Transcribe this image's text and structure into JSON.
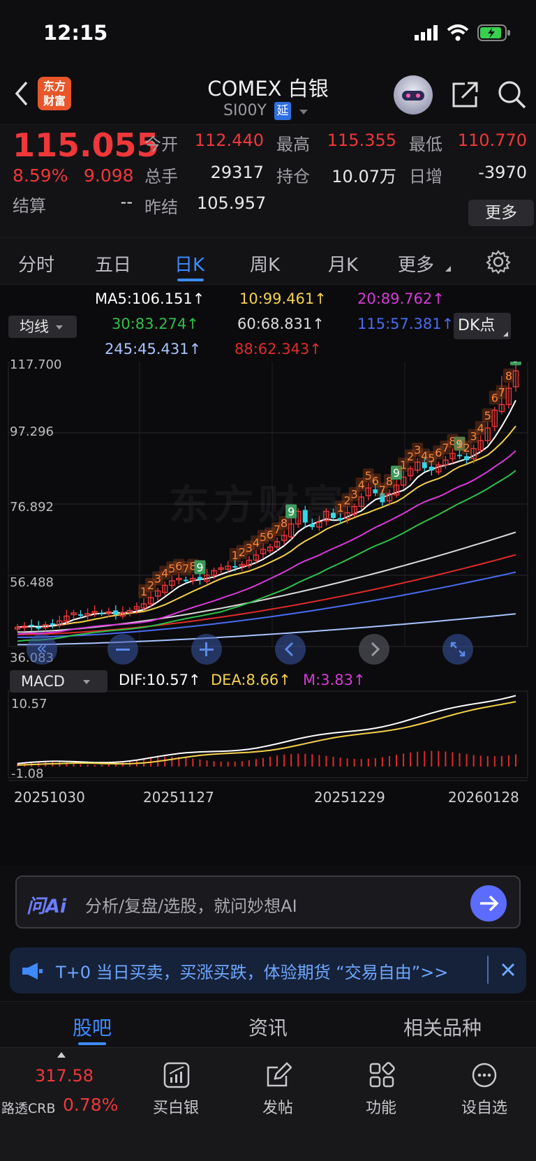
{
  "status": {
    "time": "12:15"
  },
  "header": {
    "title": "COMEX 白银",
    "code": "SI00Y",
    "delay_badge": "延",
    "logo_line1": "东方",
    "logo_line2": "财富"
  },
  "quote": {
    "price": "115.055",
    "change_pct": "8.59%",
    "change": "9.098",
    "settle_label": "结算",
    "settle_value": "--",
    "fields": [
      {
        "label": "今开",
        "value": "112.440",
        "color": "#f0373a"
      },
      {
        "label": "最高",
        "value": "115.355",
        "color": "#f0373a"
      },
      {
        "label": "最低",
        "value": "110.770",
        "color": "#f0373a"
      },
      {
        "label": "总手",
        "value": "29317",
        "color": "#e8e8e8"
      },
      {
        "label": "持仓",
        "value": "10.07万",
        "color": "#e8e8e8"
      },
      {
        "label": "日增",
        "value": "-3970",
        "color": "#e8e8e8"
      },
      {
        "label": "昨结",
        "value": "105.957",
        "color": "#e8e8e8"
      }
    ],
    "more_label": "更多"
  },
  "period_tabs": [
    {
      "label": "分时",
      "active": false
    },
    {
      "label": "五日",
      "active": false
    },
    {
      "label": "日K",
      "active": true
    },
    {
      "label": "周K",
      "active": false
    },
    {
      "label": "月K",
      "active": false
    },
    {
      "label": "更多",
      "active": false
    }
  ],
  "ma": {
    "selector": "均线",
    "dk_label": "DK点",
    "items": [
      {
        "text": "MA5:106.151↑",
        "color": "#ffffff"
      },
      {
        "text": "10:99.461↑",
        "color": "#f5d14a"
      },
      {
        "text": "20:89.762↑",
        "color": "#d83ad8"
      },
      {
        "text": "30:83.274↑",
        "color": "#2fbf4a"
      },
      {
        "text": "60:68.831↑",
        "color": "#dcdcdc"
      },
      {
        "text": "115:57.381↑",
        "color": "#4a6cf0"
      },
      {
        "text": "245:45.431↑",
        "color": "#a9c4ff"
      },
      {
        "text": "88:62.343↑",
        "color": "#e02a2a"
      }
    ]
  },
  "chart_data": [
    {
      "type": "candlestick",
      "y_ticks": [
        "117.700",
        "97.296",
        "76.892",
        "56.488",
        "36.083"
      ],
      "ylim": [
        36.083,
        117.7
      ],
      "watermark": "东方财富",
      "close": [
        41.6,
        41.9,
        42.0,
        41.5,
        42.3,
        42.6,
        43.4,
        44.8,
        45.7,
        44.9,
        45.5,
        46.1,
        45.6,
        46.0,
        45.2,
        45.8,
        46.4,
        47.5,
        48.3,
        50.1,
        52.0,
        53.6,
        54.9,
        55.6,
        54.9,
        55.6,
        55.2,
        56.5,
        57.8,
        58.6,
        59.1,
        58.7,
        59.6,
        60.8,
        62.3,
        63.9,
        64.6,
        66.1,
        67.9,
        71.2,
        74.8,
        71.6,
        70.3,
        71.7,
        74.8,
        72.9,
        72.3,
        74.4,
        76.2,
        78.9,
        81.5,
        80.0,
        77.4,
        79.9,
        82.3,
        84.6,
        87.0,
        88.9,
        87.2,
        86.5,
        88.1,
        89.5,
        91.4,
        90.6,
        89.5,
        92.8,
        95.1,
        98.7,
        103.8,
        105.4,
        110.1,
        115.055
      ],
      "up_seq": [
        "1",
        "2",
        "3",
        "4",
        "5",
        "6",
        "7",
        "8",
        "9"
      ]
    },
    {
      "type": "bar+line",
      "title": "MACD",
      "dif": "DIF:10.57↑",
      "dea": "DEA:8.66↑",
      "m": "M:3.83↑",
      "y_top": "10.57",
      "y_bottom": "-1.08",
      "x_labels": [
        "20251030",
        "20251127",
        "20251229",
        "20260128"
      ]
    }
  ],
  "ai": {
    "logo": "问Ai",
    "placeholder": "分析/复盘/选股，就问妙想AI"
  },
  "promo": {
    "text": "T+0 当日买卖，买涨买跌，体验期货 “交易自由”>>"
  },
  "sub_tabs": [
    {
      "label": "股吧",
      "active": true
    },
    {
      "label": "资讯",
      "active": false
    },
    {
      "label": "相关品种",
      "active": false
    }
  ],
  "bottom": {
    "crb_value": "317.58",
    "crb_label": "路透CRB",
    "crb_pct": "0.78%",
    "actions": [
      "买白银",
      "发帖",
      "功能",
      "设自选"
    ]
  }
}
